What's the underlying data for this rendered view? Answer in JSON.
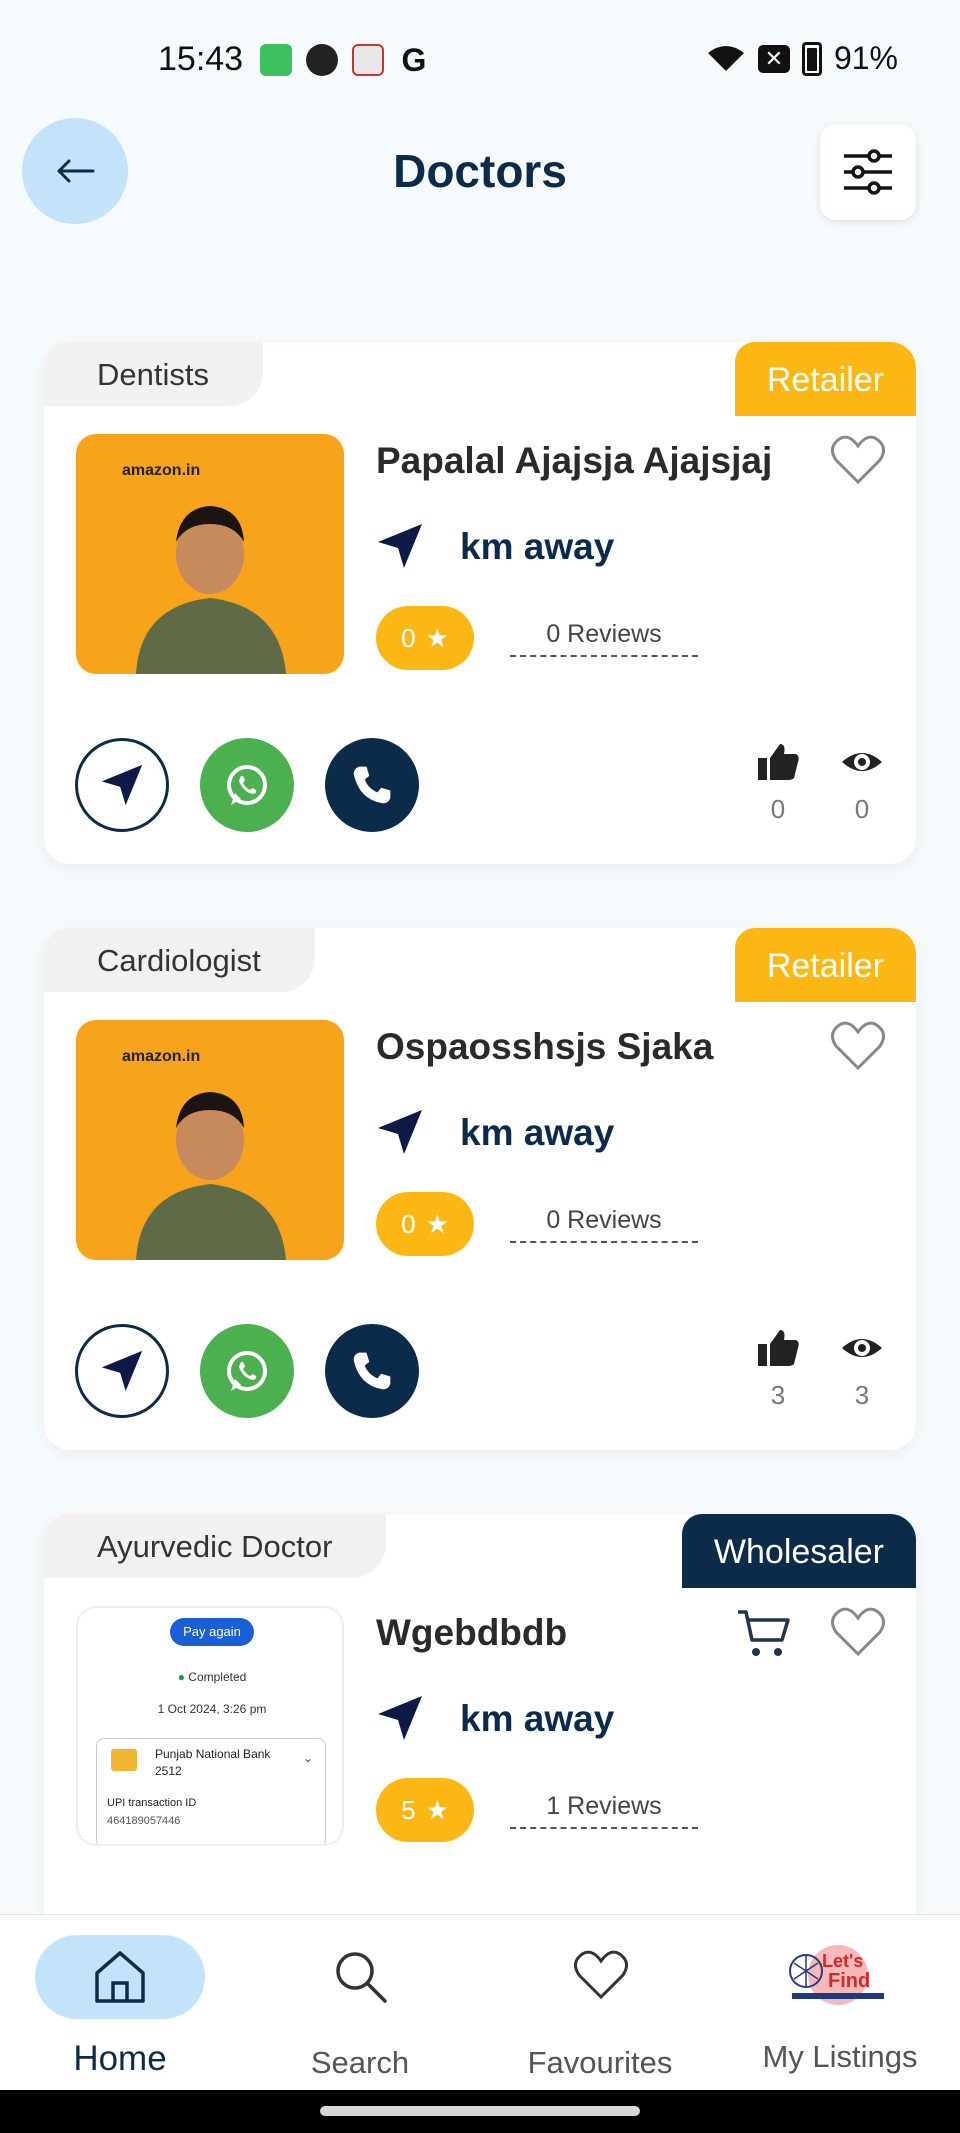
{
  "status_bar": {
    "time": "15:43",
    "battery": "91%"
  },
  "header": {
    "title": "Doctors"
  },
  "listings": [
    {
      "category": "Dentists",
      "type": "Retailer",
      "name": "Papalal Ajajsja Ajajsjaj",
      "distance": "km away",
      "rating": "0",
      "reviews": "0 Reviews",
      "likes": "0",
      "views": "0",
      "thumb_brand": "amazon.in"
    },
    {
      "category": "Cardiologist",
      "type": "Retailer",
      "name": "Ospaosshsjs Sjaka",
      "distance": "km away",
      "rating": "0",
      "reviews": "0 Reviews",
      "likes": "3",
      "views": "3",
      "thumb_brand": "amazon.in"
    },
    {
      "category": "Ayurvedic Doctor",
      "type": "Wholesaler",
      "name": "Wgebdbdb",
      "distance": "km away",
      "rating": "5",
      "reviews": "1 Reviews",
      "thumb": {
        "button": "Pay again",
        "status": "Completed",
        "date": "1 Oct 2024, 3:26 pm",
        "bank": "Punjab National Bank",
        "account": "2512",
        "txn_label": "UPI transaction ID",
        "txn_id": "464189057446"
      }
    }
  ],
  "bottom_nav": {
    "home": "Home",
    "search": "Search",
    "favourites": "Favourites",
    "my_listings": "My Listings",
    "logo_text": "Let's Find"
  },
  "colors": {
    "navy": "#0c2b4b",
    "yellow": "#fdb714",
    "light_blue": "#c5e2fb",
    "whatsapp": "#4caf50"
  }
}
